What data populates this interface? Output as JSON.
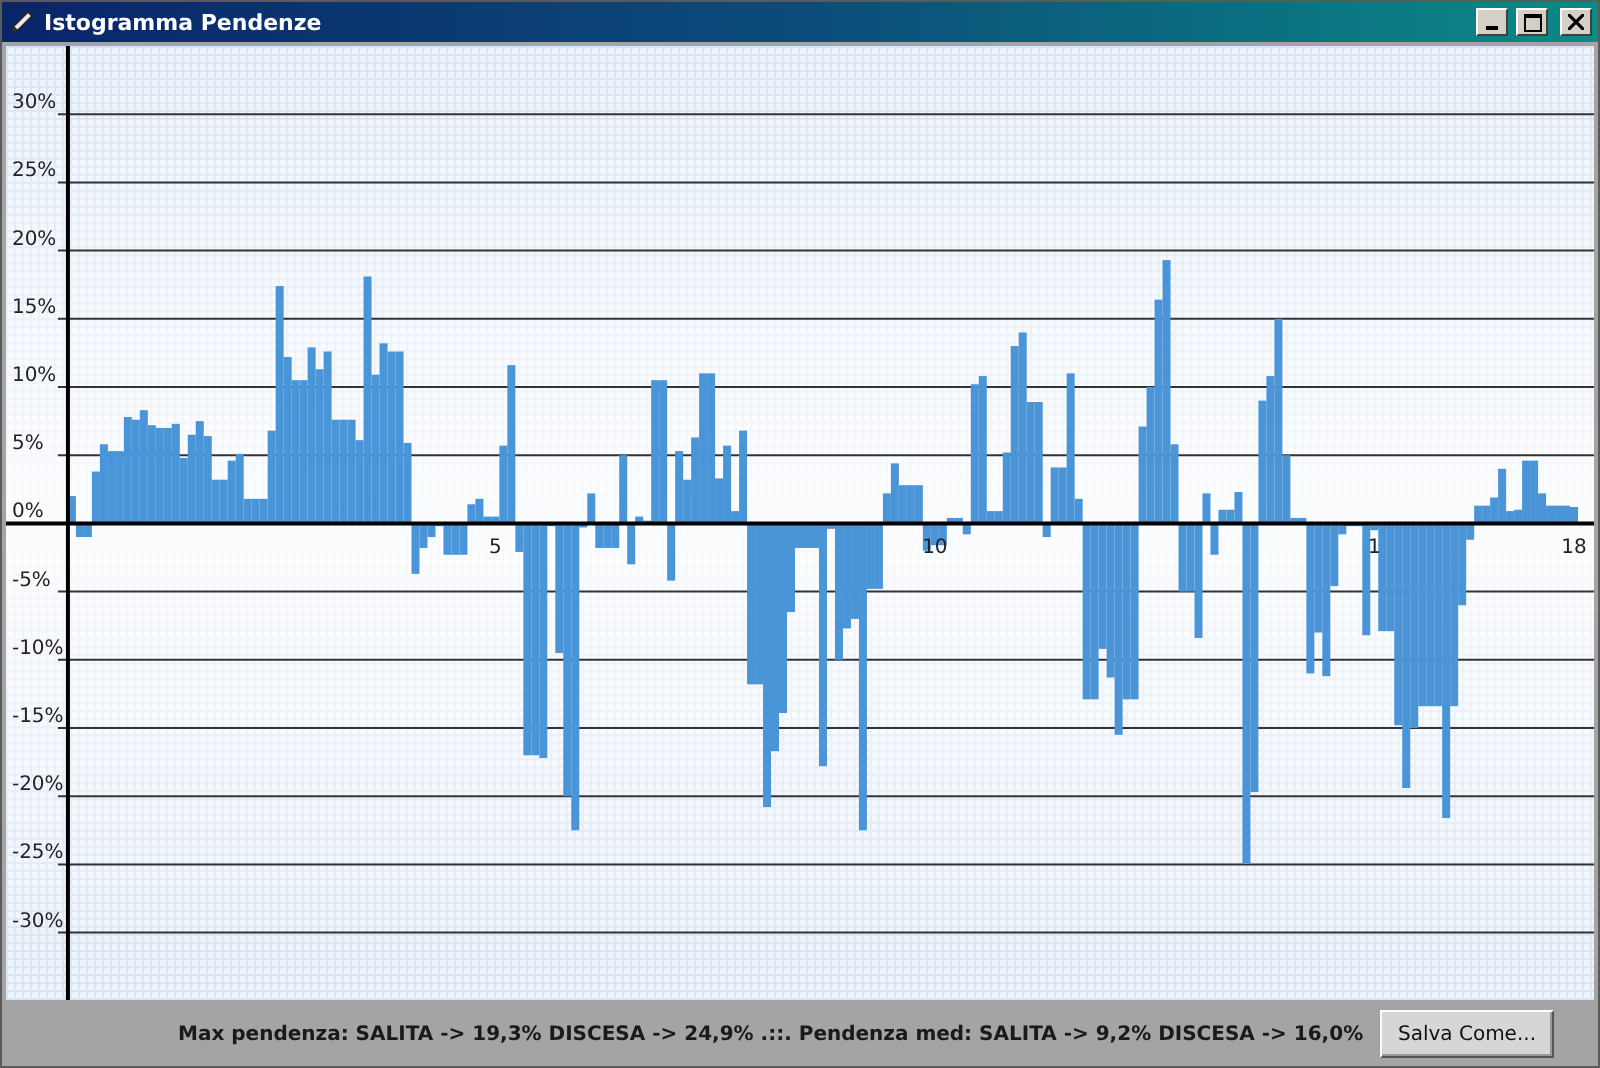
{
  "window": {
    "title": "Istogramma Pendenze"
  },
  "chart": {
    "chart_data": {
      "type": "bar",
      "ylim": [
        -35,
        35
      ],
      "grid": true,
      "categories": [
        null,
        null,
        null,
        null,
        null,
        null,
        null,
        null,
        null,
        null,
        null,
        null,
        null,
        null,
        null,
        null,
        null,
        null,
        null,
        null,
        null,
        null,
        null,
        null,
        null,
        null,
        null,
        null,
        null,
        null,
        null,
        null,
        null,
        null,
        null,
        null,
        null,
        null,
        null,
        null,
        null,
        null,
        null,
        null,
        null,
        null,
        null,
        null,
        null,
        null,
        null,
        null,
        null,
        "5",
        null,
        null,
        null,
        null,
        null,
        null,
        null,
        null,
        null,
        null,
        null,
        null,
        null,
        null,
        null,
        null,
        null,
        null,
        null,
        null,
        null,
        null,
        null,
        null,
        null,
        null,
        null,
        null,
        null,
        null,
        null,
        null,
        null,
        null,
        null,
        null,
        null,
        null,
        null,
        null,
        null,
        null,
        null,
        null,
        null,
        null,
        null,
        null,
        null,
        null,
        null,
        null,
        null,
        null,
        "10",
        null,
        null,
        null,
        null,
        null,
        null,
        null,
        null,
        null,
        null,
        null,
        null,
        null,
        null,
        null,
        null,
        null,
        null,
        null,
        null,
        null,
        null,
        null,
        null,
        null,
        null,
        null,
        null,
        null,
        null,
        null,
        null,
        null,
        null,
        null,
        null,
        null,
        null,
        null,
        null,
        null,
        null,
        null,
        null,
        null,
        null,
        null,
        null,
        null,
        null,
        null,
        null,
        null,
        null,
        "1",
        null,
        null,
        null,
        null,
        null,
        null,
        null,
        null,
        null,
        null,
        null,
        null,
        null,
        null,
        null,
        null,
        null,
        null,
        null,
        null,
        null,
        null,
        null,
        null,
        "18"
      ],
      "yticks": [
        {
          "value": 30,
          "label": "30%"
        },
        {
          "value": 25,
          "label": "25%"
        },
        {
          "value": 20,
          "label": "20%"
        },
        {
          "value": 15,
          "label": "15%"
        },
        {
          "value": 10,
          "label": "10%"
        },
        {
          "value": 5,
          "label": "5%"
        },
        {
          "value": 0,
          "label": "0%"
        },
        {
          "value": -5,
          "label": "-5%"
        },
        {
          "value": -10,
          "label": "-10%"
        },
        {
          "value": -15,
          "label": "-15%"
        },
        {
          "value": -20,
          "label": "-20%"
        },
        {
          "value": -25,
          "label": "-25%"
        },
        {
          "value": -30,
          "label": "-30%"
        }
      ],
      "values": [
        2,
        -1,
        -1,
        3.8,
        5.8,
        5.3,
        5.3,
        7.8,
        7.6,
        8.3,
        7.2,
        7,
        7,
        7.3,
        4.8,
        6.5,
        7.5,
        6.4,
        3.2,
        3.2,
        4.6,
        5.1,
        1.8,
        1.8,
        1.8,
        6.8,
        17.4,
        12.2,
        10.5,
        10.5,
        12.9,
        11.3,
        12.6,
        7.6,
        7.6,
        7.6,
        6.1,
        18.1,
        10.9,
        13.2,
        12.6,
        12.6,
        5.9,
        -3.7,
        -1.8,
        -1,
        -0.2,
        -2.3,
        -2.3,
        -2.3,
        1.4,
        1.8,
        0.5,
        0.5,
        5.7,
        11.6,
        -2.1,
        -17,
        -17,
        -17.2,
        -0.2,
        -9.5,
        -20,
        -22.5,
        -0.3,
        2.2,
        -1.8,
        -1.8,
        -1.8,
        5,
        -3,
        0.5,
        0.2,
        10.5,
        10.5,
        -4.2,
        5.3,
        3.2,
        6.3,
        11,
        11,
        3.3,
        5.7,
        0.9,
        6.8,
        -11.8,
        -11.8,
        -20.8,
        -16.7,
        -13.9,
        -6.5,
        -1.8,
        -1.8,
        -1.8,
        -17.8,
        -0.4,
        -10,
        -7.7,
        -7,
        -22.5,
        -4.8,
        -4.8,
        2.2,
        4.4,
        2.8,
        2.8,
        2.8,
        -2,
        -1.6,
        -1.6,
        0.4,
        0.4,
        -0.8,
        10.2,
        10.8,
        0.9,
        0.9,
        5.2,
        13,
        14,
        8.9,
        8.9,
        -1,
        4.1,
        4.1,
        11,
        1.8,
        -12.9,
        -12.9,
        -9.2,
        -11.3,
        -15.5,
        -12.9,
        -12.9,
        7.1,
        10,
        16.4,
        19.3,
        5.8,
        -5,
        -5,
        -8.4,
        2.2,
        -2.3,
        1,
        1,
        2.3,
        -24.9,
        -19.7,
        9,
        10.8,
        15,
        5,
        0.4,
        0.4,
        -11,
        -8,
        -11.2,
        -4.6,
        -0.8,
        -0.2,
        -0.2,
        -8.2,
        -0.5,
        -7.9,
        -7.9,
        -14.8,
        -19.4,
        -15,
        -13.4,
        -13.4,
        -13.4,
        -21.6,
        -13.4,
        -6,
        -1.2,
        1.3,
        1.3,
        1.9,
        4,
        0.9,
        1,
        4.6,
        4.6,
        2.2,
        1.3,
        1.3,
        1.3,
        1.2
      ]
    }
  },
  "status": {
    "text": "Max pendenza: SALITA -> 19,3% DISCESA -> 24,9% .::. Pendenza med: SALITA -> 9,2% DISCESA -> 16,0%"
  },
  "buttons": [
    {
      "label": "Salva Come..."
    }
  ]
}
